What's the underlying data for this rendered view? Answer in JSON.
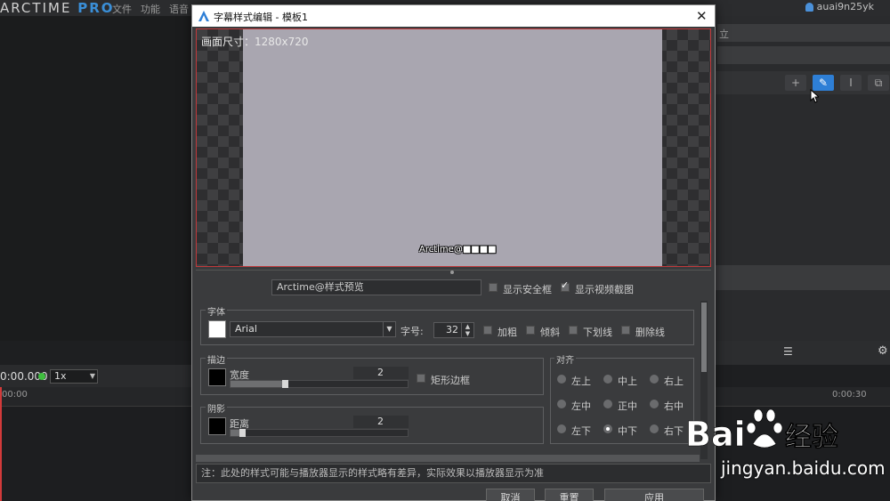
{
  "app": {
    "logo_text": "ARCTIME",
    "logo_pro": "PRO",
    "menus": [
      "文件",
      "功能",
      "语音"
    ],
    "username": "auai9n25yk",
    "accent_color": "#2e7fd6"
  },
  "right_panel": {
    "row1_text": "立",
    "toolbar": [
      "+",
      "✎",
      "I",
      "⧉"
    ]
  },
  "timeline": {
    "time": "0:00.000",
    "speed": "1x",
    "ruler_left": "00:00",
    "ruler_right": "0:00:30"
  },
  "dialog": {
    "title": "字幕样式编辑 - 模板1",
    "close_glyph": "✕",
    "preview_size_label": "画面尺寸：1280x720",
    "preview_sample_text": "Arctime@■■■■",
    "preview_text_value": "Arctime@样式预览",
    "show_safe_frame": {
      "label": "显示安全框",
      "checked": false
    },
    "show_video_frame": {
      "label": "显示视频截图",
      "checked": true
    },
    "font_group": {
      "title": "字体",
      "font_color": "#ffffff",
      "font_name": "Arial",
      "size_label": "字号:",
      "size_value": "32",
      "bold": "加粗",
      "italic": "倾斜",
      "underline": "下划线",
      "strike": "删除线"
    },
    "outline_group": {
      "title": "描边",
      "color": "#000000",
      "width_label": "宽度",
      "width_value": "2",
      "width_level": 0.3,
      "rect_border_label": "矩形边框"
    },
    "shadow_group": {
      "title": "阴影",
      "color": "#000000",
      "distance_label": "距离",
      "distance_value": "2",
      "distance_level": 0.05
    },
    "align_group": {
      "title": "对齐",
      "options": [
        "左上",
        "中上",
        "右上",
        "左中",
        "正中",
        "右中",
        "左下",
        "中下",
        "右下"
      ],
      "selected": "中下"
    },
    "note": "注：此处的样式可能与播放器显示的样式略有差异，实际效果以播放器显示为准",
    "buttons": {
      "cancel": "取消",
      "reset": "重置",
      "apply": "应用"
    }
  },
  "watermark": {
    "url": "jingyan.baidu.com"
  }
}
